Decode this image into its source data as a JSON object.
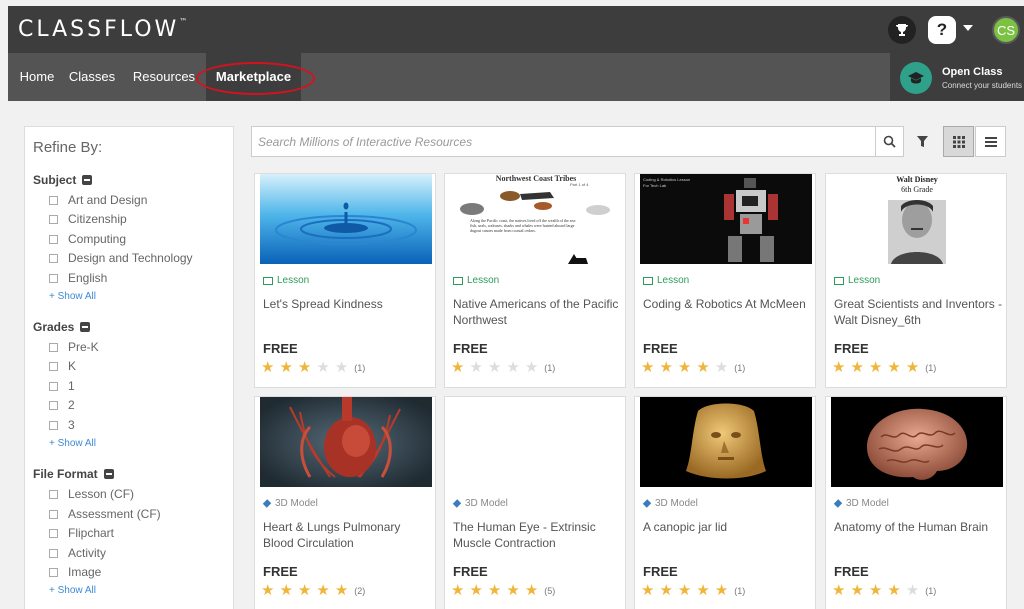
{
  "header": {
    "logo": "CLASSFLOW",
    "logo_tm": "™",
    "help_label": "?",
    "avatar_initials": "CS"
  },
  "nav": {
    "items": [
      {
        "label": "Home"
      },
      {
        "label": "Classes"
      },
      {
        "label": "Resources"
      },
      {
        "label": "Marketplace",
        "active": true
      }
    ],
    "open_class_title": "Open Class",
    "open_class_sub": "Connect your students"
  },
  "sidebar": {
    "title": "Refine By:",
    "facets": [
      {
        "name": "Subject",
        "options": [
          "Art and Design",
          "Citizenship",
          "Computing",
          "Design and Technology",
          "English"
        ],
        "show_all": "+ Show All"
      },
      {
        "name": "Grades",
        "options": [
          "Pre-K",
          "K",
          "1",
          "2",
          "3"
        ],
        "show_all": "+ Show All"
      },
      {
        "name": "File Format",
        "options": [
          "Lesson (CF)",
          "Assessment (CF)",
          "Flipchart",
          "Activity",
          "Image"
        ],
        "show_all": "+ Show All"
      }
    ]
  },
  "search": {
    "placeholder": "Search Millions of Interactive Resources"
  },
  "cards": [
    {
      "type": "Lesson",
      "title": "Let's Spread Kindness",
      "price": "FREE",
      "rating": 3,
      "count": "(1)"
    },
    {
      "type": "Lesson",
      "title": "Native Americans of the Pacific Northwest",
      "price": "FREE",
      "rating": 1,
      "count": "(1)",
      "thumb_title": "Northwest Coast Tribes",
      "thumb_sub": "Part 1 of 4",
      "thumb_text": "Along the Pacific coast, the natives lived off the wealth of the sea: fish, seals, walruses, sharks and whales were hunted aboard large dugout canoes made from coastal cedars."
    },
    {
      "type": "Lesson",
      "title": "Coding & Robotics At McMeen",
      "price": "FREE",
      "rating": 4,
      "count": "(1)",
      "thumb_title": "Coding & Robotics Lesson",
      "thumb_sub": "For Tech Lab"
    },
    {
      "type": "Lesson",
      "title": "Great Scientists and Inventors - Walt Disney_6th",
      "price": "FREE",
      "rating": 5,
      "count": "(1)",
      "thumb_title": "Walt Disney",
      "thumb_sub": "6th Grade"
    },
    {
      "type": "3D Model",
      "title": "Heart & Lungs Pulmonary Blood Circulation",
      "price": "FREE",
      "rating": 5,
      "count": "(2)"
    },
    {
      "type": "3D Model",
      "title": "The Human Eye - Extrinsic Muscle Contraction",
      "price": "FREE",
      "rating": 5,
      "count": "(5)"
    },
    {
      "type": "3D Model",
      "title": "A canopic jar lid",
      "price": "FREE",
      "rating": 5,
      "count": "(1)"
    },
    {
      "type": "3D Model",
      "title": "Anatomy of the Human Brain",
      "price": "FREE",
      "rating": 4,
      "count": "(1)"
    }
  ],
  "colors": {
    "header_dark": "#3d3d3d",
    "nav_grey": "#545454",
    "accent_green": "#2e9b5b",
    "star_gold": "#f0b63c",
    "highlight_red": "#d6121f"
  }
}
